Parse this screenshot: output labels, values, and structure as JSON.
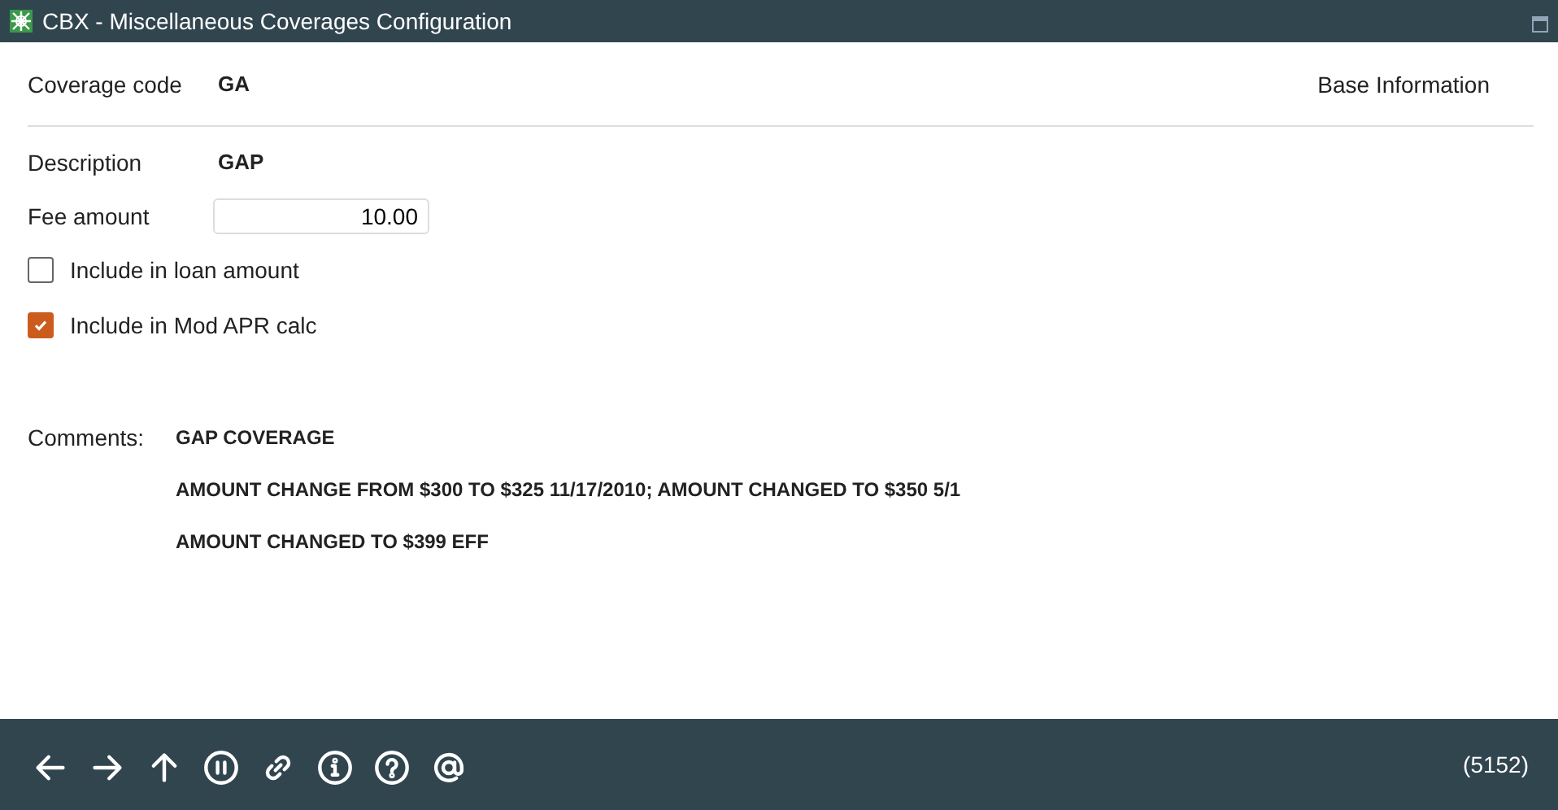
{
  "window": {
    "title": "CBX - Miscellaneous Coverages Configuration"
  },
  "header": {
    "code_label": "Coverage code",
    "code_value": "GA",
    "section": "Base Information"
  },
  "description": {
    "label": "Description",
    "value": "GAP"
  },
  "fee": {
    "label": "Fee amount",
    "value": "10.00"
  },
  "options": [
    {
      "label": "Include in loan amount",
      "checked": false
    },
    {
      "label": "Include in Mod APR calc",
      "checked": true
    }
  ],
  "comments": {
    "label": "Comments:",
    "lines": [
      "GAP COVERAGE",
      "AMOUNT CHANGE FROM $300 TO $325 11/17/2010; AMOUNT CHANGED TO $350 5/1",
      "AMOUNT CHANGED TO $399 EFF"
    ]
  },
  "status_bar": {
    "code": "(5152)"
  }
}
